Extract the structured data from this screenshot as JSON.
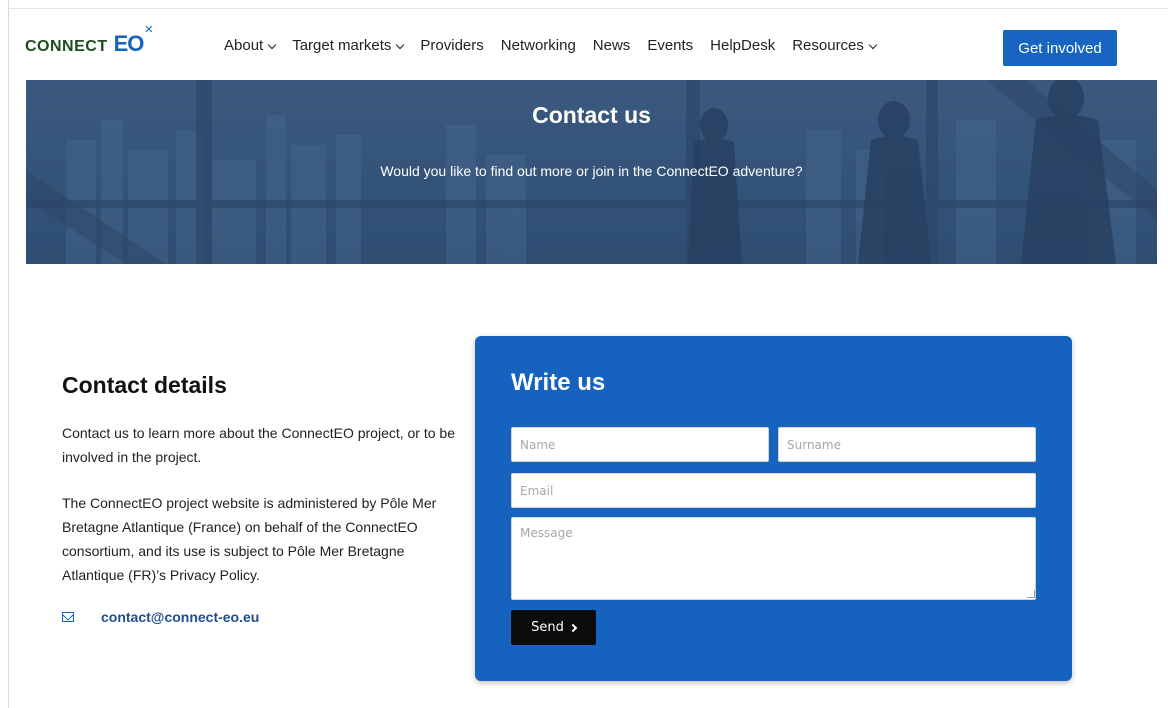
{
  "header": {
    "logo": {
      "word": "CONNECT",
      "mark": "EO"
    },
    "nav": [
      {
        "label": "About",
        "has_dropdown": true
      },
      {
        "label": "Target markets",
        "has_dropdown": true
      },
      {
        "label": "Providers",
        "has_dropdown": false
      },
      {
        "label": "Networking",
        "has_dropdown": false
      },
      {
        "label": "News",
        "has_dropdown": false
      },
      {
        "label": "Events",
        "has_dropdown": false
      },
      {
        "label": "HelpDesk",
        "has_dropdown": false
      },
      {
        "label": "Resources",
        "has_dropdown": true
      }
    ],
    "cta_label": "Get involved"
  },
  "hero": {
    "title": "Contact us",
    "subtitle": "Would you like to find out more or join in the ConnectEO adventure?"
  },
  "details": {
    "heading": "Contact details",
    "paragraph_1": "Contact us to learn more about the ConnectEO project, or to be involved in the project.",
    "paragraph_2": "The ConnectEO project website is administered by Pôle Mer Bretagne Atlantique (France) on behalf of the ConnectEO consortium, and its use is subject to Pôle Mer Bretagne Atlantique (FR)’s Privacy Policy.",
    "email": "contact@connect-eo.eu"
  },
  "form": {
    "heading": "Write us",
    "name_placeholder": "Name",
    "surname_placeholder": "Surname",
    "email_placeholder": "Email",
    "message_placeholder": "Message",
    "send_label": "Send"
  },
  "colors": {
    "brand_blue": "#1765c1",
    "logo_green": "#1f4d1f",
    "hero_overlay": "#36557a"
  }
}
